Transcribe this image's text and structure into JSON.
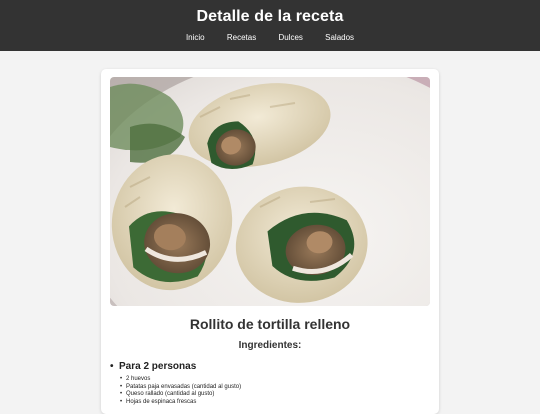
{
  "header": {
    "title": "Detalle de la receta",
    "nav": [
      "Inicio",
      "Recetas",
      "Dulces",
      "Salados"
    ]
  },
  "recipe": {
    "title": "Rollito de tortilla relleno",
    "ingredients_heading": "Ingredientes:",
    "servings": "Para 2 personas",
    "ingredients": [
      "2 huevos",
      "Patatas paja envasadas (cantidad al gusto)",
      "Queso rallado (cantidad al gusto)",
      "Hojas de espinaca frescas"
    ]
  }
}
